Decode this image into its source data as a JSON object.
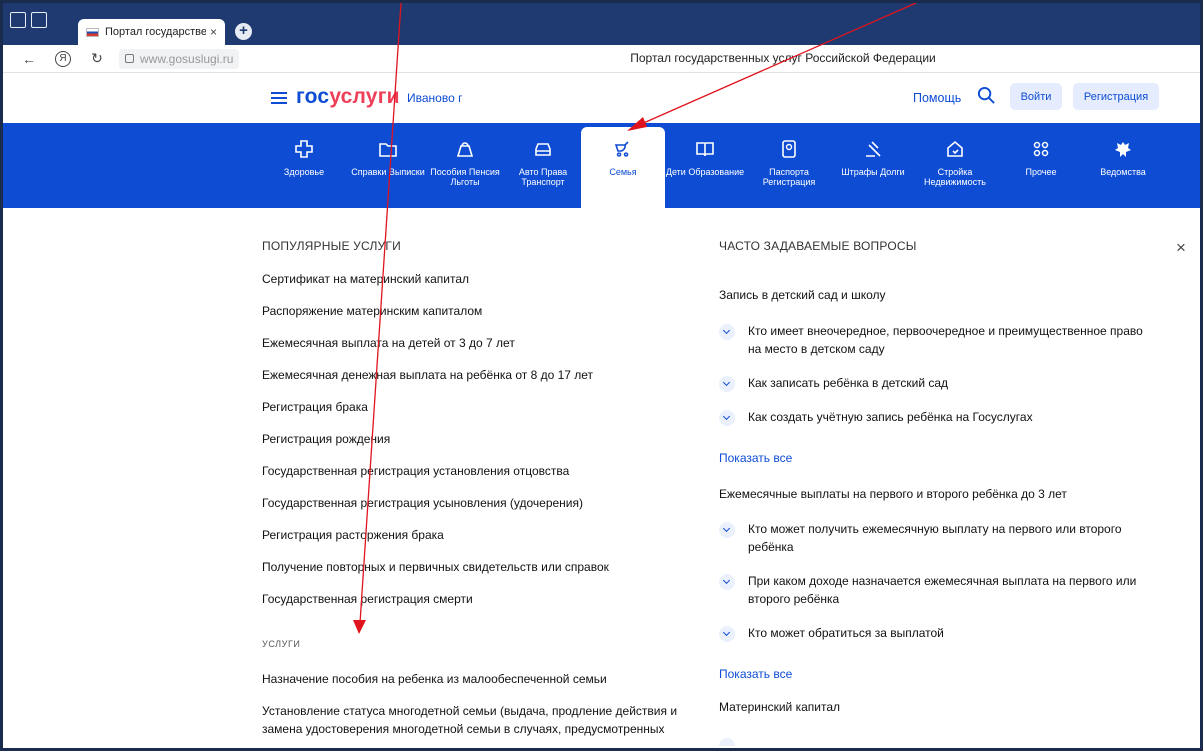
{
  "browser": {
    "tab_title": "Портал государственны",
    "tab_close": "×",
    "newtab_label": "+",
    "url": "www.gosuslugi.ru",
    "page_title": "Портал государственных услуг Российской Федерации",
    "ya_label": "Я"
  },
  "header": {
    "logo_gos": "гос",
    "logo_uslugi": "услуги",
    "city": "Иваново г",
    "help": "Помощь",
    "login": "Войти",
    "register": "Регистрация"
  },
  "categories": [
    {
      "label": "Здоровье",
      "icon": "health-cross-icon"
    },
    {
      "label": "Справки Выписки",
      "icon": "folder-icon"
    },
    {
      "label": "Пособия Пенсия Льготы",
      "icon": "bag-icon"
    },
    {
      "label": "Авто Права Транспорт",
      "icon": "car-icon"
    },
    {
      "label": "Семья",
      "icon": "stroller-icon"
    },
    {
      "label": "Дети Образование",
      "icon": "book-icon"
    },
    {
      "label": "Паспорта Регистрация",
      "icon": "passport-icon"
    },
    {
      "label": "Штрафы Долги",
      "icon": "gavel-icon"
    },
    {
      "label": "Стройка Недвижимость",
      "icon": "house-icon"
    },
    {
      "label": "Прочее",
      "icon": "grid-icon"
    },
    {
      "label": "Ведомства",
      "icon": "emblem-icon"
    }
  ],
  "popular": {
    "title": "ПОПУЛЯРНЫЕ УСЛУГИ",
    "items": [
      "Сертификат на материнский капитал",
      "Распоряжение материнским капиталом",
      "Ежемесячная выплата на детей от 3 до 7 лет",
      "Ежемесячная денежная выплата на ребёнка от 8 до 17 лет",
      "Регистрация брака",
      "Регистрация рождения",
      "Государственная регистрация установления отцовства",
      "Государственная регистрация усыновления (удочерения)",
      "Регистрация расторжения брака",
      "Получение повторных и первичных свидетельств или справок",
      "Государственная регистрация смерти"
    ]
  },
  "services": {
    "title": "УСЛУГИ",
    "items": [
      "Назначение пособия на ребенка из малообеспеченной семьи",
      "Установление статуса многодетной семьи (выдача, продление действия и замена удостоверения многодетной семьи в случаях, предусмотренных"
    ]
  },
  "faq": {
    "title": "ЧАСТО ЗАДАВАЕМЫЕ ВОПРОСЫ",
    "show_all": "Показать все",
    "groups": [
      {
        "title": "Запись в детский сад и школу",
        "questions": [
          "Кто имеет внеочередное, первоочередное и преимущественное право на место в детском саду",
          "Как записать ребёнка в детский сад",
          "Как создать учётную запись ребёнка на Госуслугах"
        ]
      },
      {
        "title": "Ежемесячные выплаты на первого и второго ребёнка до 3 лет",
        "questions": [
          "Кто может получить ежемесячную выплату на первого или второго ребёнка",
          "При каком доходе назначается ежемесячная выплата на первого или второго ребёнка",
          "Кто может обратиться за выплатой"
        ]
      },
      {
        "title": "Материнский капитал",
        "questions": []
      }
    ]
  },
  "close_label": "×",
  "colors": {
    "brand_blue": "#0d4cd3",
    "brand_red": "#ee3f58",
    "annotation_red": "#e0141e"
  }
}
